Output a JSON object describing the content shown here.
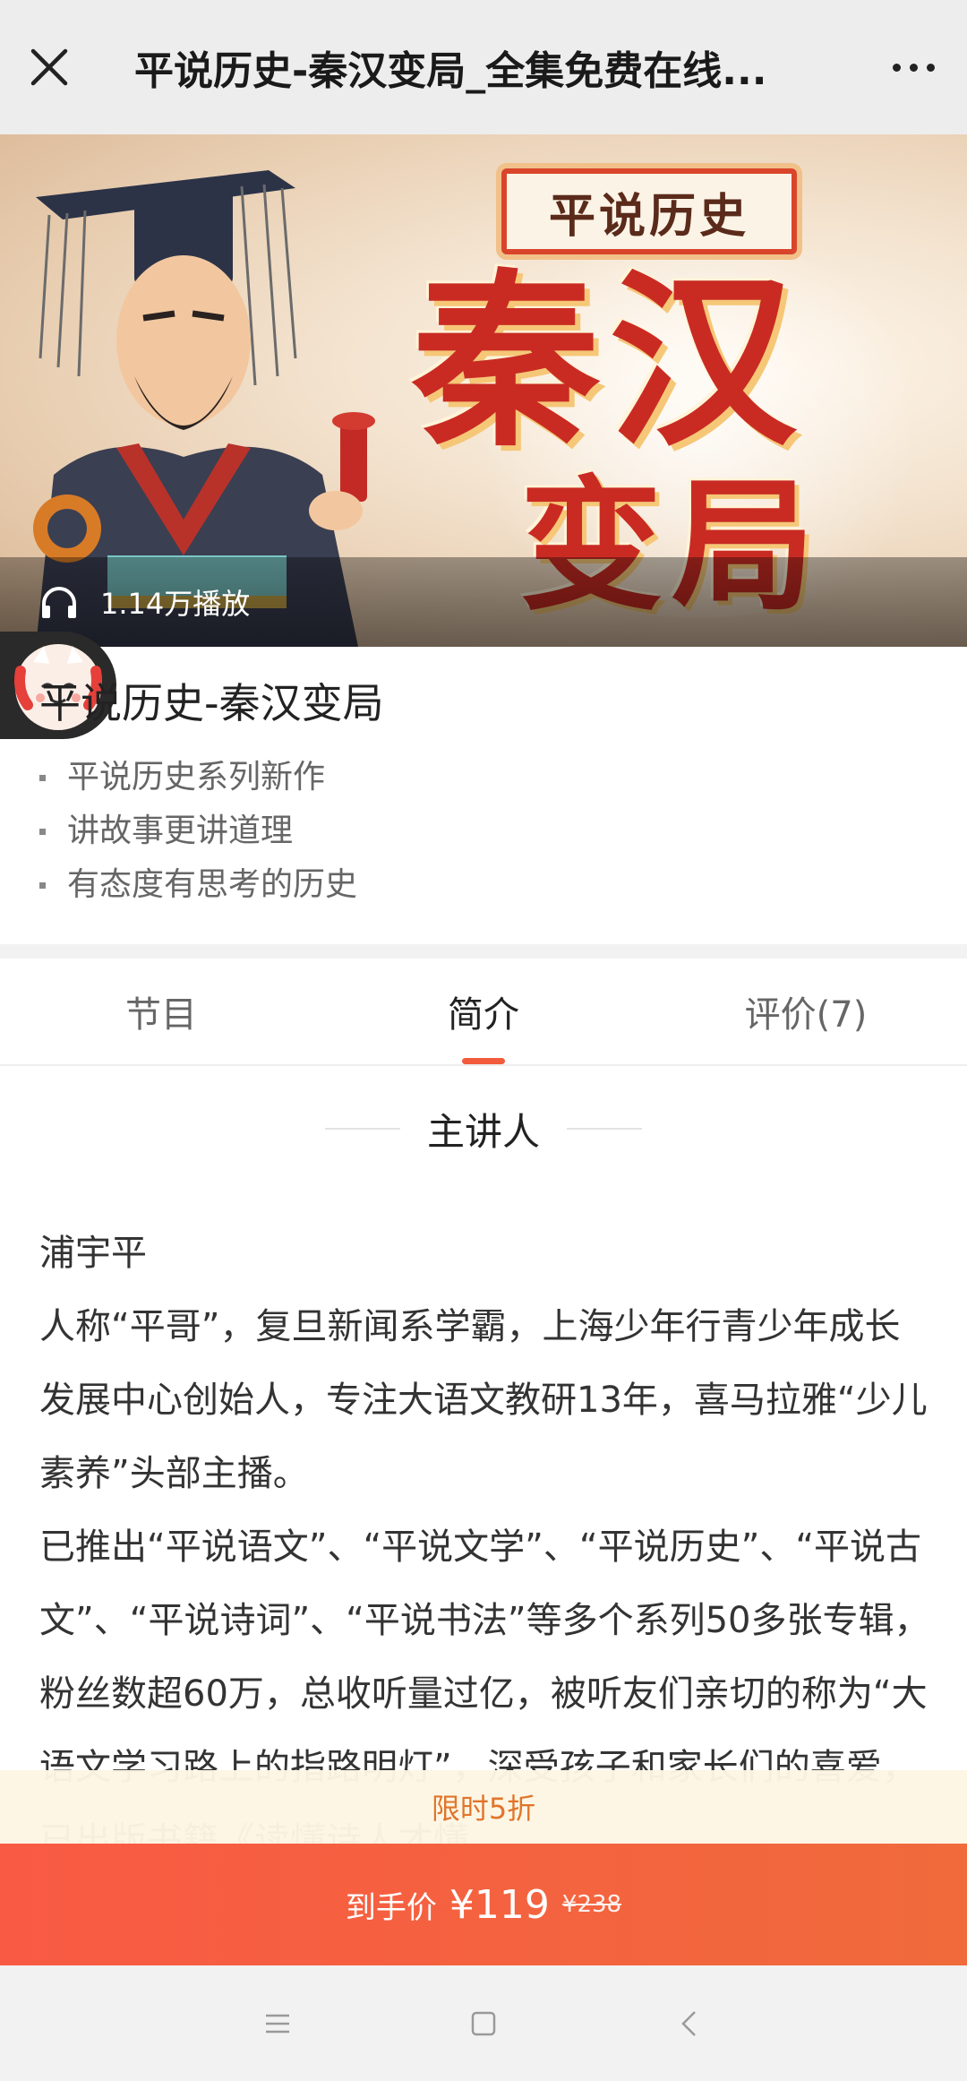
{
  "topbar": {
    "title": "平说历史-秦汉变局_全集免费在线...",
    "close_icon": "close-icon",
    "more_icon": "more-dots-icon"
  },
  "banner": {
    "series_label": "平说历史",
    "big_title_line1": "秦汉",
    "big_title_line2": "变局",
    "play_count": "1.14万播放",
    "play_icon": "headphones-icon"
  },
  "album": {
    "title": "平说历史-秦汉变局",
    "features": [
      "平说历史系列新作",
      "讲故事更讲道理",
      "有态度有思考的历史"
    ]
  },
  "tabs": [
    {
      "label": "节目",
      "active": false
    },
    {
      "label": "简介",
      "active": true
    },
    {
      "label": "评价(7)",
      "active": false
    }
  ],
  "section": {
    "heading": "主讲人"
  },
  "intro": {
    "name": "浦宇平",
    "para1": "人称“平哥”，复旦新闻系学霸，上海少年行青少年成长发展中心创始人，专注大语文教研13年，喜马拉雅“少儿素养”头部主播。",
    "para2": "已推出“平说语文”、“平说文学”、“平说历史”、“平说古文”、“平说诗词”、“平说书法”等多个系列50多张专辑，粉丝数超60万，总收听量过亿，被听友们亲切的称为“大语文学习路上的指路明灯”，深受孩子和家长们的喜爱，已出版书籍《读懂诗人才懂"
  },
  "promo": {
    "text": "限时5折"
  },
  "buy": {
    "label": "到手价",
    "price": "¥119",
    "original_price": "¥238"
  },
  "colors": {
    "accent": "#f25c3c",
    "promo_text": "#e0752b",
    "buy_bar": "#f95a43"
  }
}
